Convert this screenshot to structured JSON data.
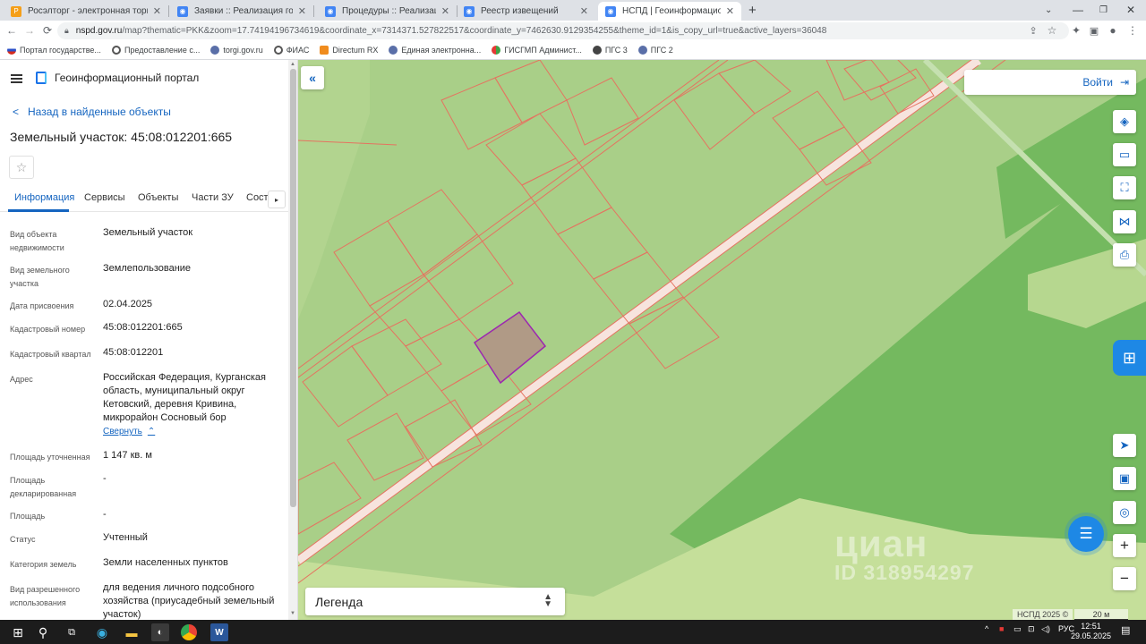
{
  "browser": {
    "tabs": [
      {
        "title": "Росэлторг - электронная торгов",
        "favicon_color": "#f59f19"
      },
      {
        "title": "Заявки :: Реализация госимущес",
        "favicon_color": "#4285f4"
      },
      {
        "title": "Процедуры :: Реализация госим",
        "favicon_color": "#4285f4"
      },
      {
        "title": "Реестр извещений",
        "favicon_color": "#4285f4"
      },
      {
        "title": "НСПД | Геоинформационный п",
        "favicon_color": "#4285f4"
      }
    ],
    "new_tab": "+",
    "url_host": "nspd.gov.ru",
    "url_path": "/map?thematic=PKK&zoom=17.74194196734619&coordinate_x=7314371.527822517&coordinate_y=7462630.9129354255&theme_id=1&is_copy_url=true&active_layers=36048",
    "bookmarks": [
      "Портал государстве...",
      "Предоставление с...",
      "torgi.gov.ru",
      "ФИАС",
      "Directum RX",
      "Единая электронна...",
      "ГИСГМП Админист...",
      "ПГС 3",
      "ПГС 2"
    ]
  },
  "panel": {
    "portal_name": "Геоинформационный портал",
    "back_label": "Назад в найденные объекты",
    "title": "Земельный участок: 45:08:012201:665",
    "tabs": [
      "Информация",
      "Сервисы",
      "Объекты",
      "Части ЗУ",
      "Соста"
    ],
    "properties": [
      {
        "label": "Вид объекта недвижимости",
        "value": "Земельный участок"
      },
      {
        "label": "Вид земельного участка",
        "value": "Землепользование"
      },
      {
        "label": "Дата присвоения",
        "value": "02.04.2025"
      },
      {
        "label": "Кадастровый номер",
        "value": "45:08:012201:665"
      },
      {
        "label": "Кадастровый квартал",
        "value": "45:08:012201"
      },
      {
        "label": "Адрес",
        "value": "Российская Федерация, Курганская область, муниципальный округ Кетовский, деревня Кривина, микрорайон Сосновый бор"
      },
      {
        "label": "Площадь уточненная",
        "value": "1 147 кв. м"
      },
      {
        "label": "Площадь декларированная",
        "value": "-"
      },
      {
        "label": "Площадь",
        "value": "-"
      },
      {
        "label": "Статус",
        "value": "Учтенный"
      },
      {
        "label": "Категория земель",
        "value": "Земли населенных пунктов"
      },
      {
        "label": "Вид разрешенного использования",
        "value": "для ведения личного подсобного хозяйства (приусадебный земельный участок)"
      }
    ],
    "collapse_label": "Свернуть"
  },
  "map": {
    "login_label": "Войти",
    "legend_label": "Легенда",
    "copyright": "НСПД 2025 ©",
    "scale_label": "20 м",
    "watermark": "циан",
    "watermark_id": "ID 318954297",
    "colors": {
      "land": "#a9cf88",
      "forest": "#74b95f",
      "light": "#c5df9a",
      "parcel_line": "#e57360",
      "selected": "#b09a86",
      "selected_border": "#9c27b0",
      "road": "#f7e4de"
    }
  },
  "taskbar": {
    "lang": "РУС",
    "time": "12:51",
    "date": "29.05.2025"
  }
}
